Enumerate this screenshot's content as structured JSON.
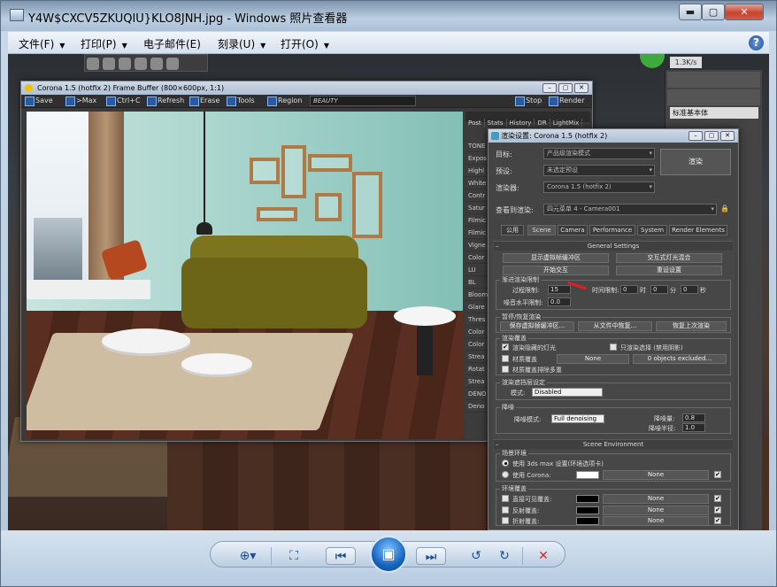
{
  "window": {
    "title": "Y4W$CXCV5ZKUQIU}KLO8JNH.jpg - Windows 照片查看器",
    "min_label": "▬",
    "max_label": "▢",
    "close_label": "✕"
  },
  "menu": {
    "items": [
      {
        "label": "文件(F)",
        "has_arrow": true
      },
      {
        "label": "打印(P)",
        "has_arrow": true
      },
      {
        "label": "电子邮件(E)",
        "has_arrow": false
      },
      {
        "label": "刻录(U)",
        "has_arrow": true
      },
      {
        "label": "打开(O)",
        "has_arrow": true
      }
    ],
    "arrow": "▼",
    "help": "?"
  },
  "background_app": {
    "counter": "1.3K/s",
    "command_dropdown": "标准基本体"
  },
  "frame_buffer": {
    "title": "Corona 1.5 (hotfix 2) Frame Buffer (800×600px, 1:1)",
    "toolbar": {
      "save": "Save",
      "max": ">Max",
      "ctrlc": "Ctrl+C",
      "refresh": "Refresh",
      "erase": "Erase",
      "tools": "Tools",
      "region": "Region",
      "pass": "BEAUTY",
      "stop": "Stop",
      "render": "Render"
    },
    "tabs": [
      "Post",
      "Stats",
      "History",
      "DR",
      "LightMix"
    ],
    "side_labels": [
      "TONE",
      "Expos",
      "Highl",
      "White",
      "Contr",
      "Satur",
      "Filmic",
      "Filmic",
      "Vigne",
      "Color",
      "LU",
      "BL",
      "Bloom",
      "Glare",
      "Thres",
      "Color",
      "Color",
      "Strea",
      "Rotat",
      "Strea",
      "DENO",
      "Deno"
    ]
  },
  "render_settings": {
    "title": "渲染设置: Corona 1.5 (hotfix 2)",
    "target_label": "目标:",
    "target_value": "产品级渲染模式",
    "preset_label": "预设:",
    "preset_value": "未选定预设",
    "renderer_label": "渲染器:",
    "renderer_value": "Corona 1.5 (hotfix 2)",
    "view_label": "查看到渲染:",
    "view_value": "四元菜单 4 - Camera001",
    "render_button": "渲染",
    "tabs": [
      "公用",
      "Scene",
      "Camera",
      "Performance",
      "System",
      "Render Elements"
    ],
    "active_tab": "Scene",
    "general": {
      "header": "General Settings",
      "btn_show_vfb": "显示虚拟帧缓冲区",
      "btn_interactive": "交互式灯光混合",
      "btn_resume": "开始交互",
      "btn_reset": "重设设置",
      "limits_title": "渐进渲染限制",
      "pass_limit_label": "过程限制:",
      "pass_limit_value": "15",
      "time_limit_label": "时间限制:",
      "time_h": "0",
      "h_label": "时",
      "time_m": "0",
      "m_label": "分",
      "time_s": "0",
      "s_label": "秒",
      "noise_label": "噪音水平限制:",
      "noise_value": "0.0",
      "resume_title": "暂停/恢复渲染",
      "btn_save_vfb": "保存虚拟帧缓冲区...",
      "btn_from_file": "从文件中恢复...",
      "btn_resume_last": "恢复上次渲染",
      "override_title": "渲染覆盖",
      "chk_hidden_lights": "渲染隐藏的灯光",
      "chk_hidden_lights_on": true,
      "chk_only_selected": "只渲染选择 (禁用阴影)",
      "chk_override_mtl": "材质覆盖",
      "override_none": "None",
      "objects_excluded": "0 objects excluded...",
      "chk_multi": "材质覆盖排除多重",
      "mblur_title": "渲染遮挡层设定",
      "mode_label": "模式:",
      "mode_value": "Disabled",
      "denoise_title": "降噪",
      "denoise_mode_label": "降噪模式:",
      "denoise_mode_value": "Full denoising",
      "denoise_amount_label": "降噪量:",
      "denoise_amount_value": "0.8",
      "denoise_radius_label": "降噪半径:",
      "denoise_radius_value": "1.0"
    },
    "environment": {
      "header": "Scene Environment",
      "scene_env_title": "场景环境",
      "radio_3dsmax": "使用 3ds max 设置(环境选项卡)",
      "radio_corona": "使用 Corona:",
      "none1": "None",
      "overrides_title": "环境覆盖",
      "chk_direct": "直接可见覆盖:",
      "chk_reflect": "反射覆盖:",
      "chk_refract": "折射覆盖:",
      "none2": "None",
      "none3": "None",
      "none4": "None"
    }
  },
  "navbar": {
    "zoom": "⊕▾",
    "actual_size": "⛶",
    "prev": "⏮",
    "slideshow": "▣",
    "next": "⏭",
    "rotate_left": "↺",
    "rotate_right": "↻",
    "delete": "✕"
  },
  "colors": {
    "accent": "#1765c0",
    "close_red": "#c74432",
    "delete_red": "#d22222",
    "sofa": "#6c6416"
  }
}
